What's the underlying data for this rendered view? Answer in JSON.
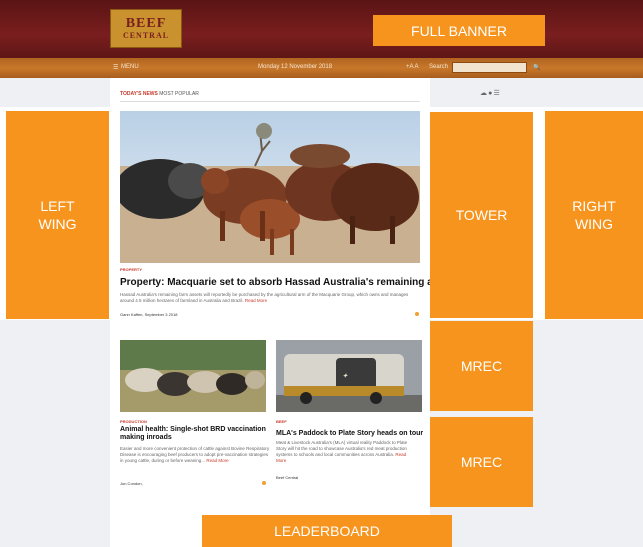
{
  "header": {
    "logo_line1": "BEEF",
    "logo_line2": "CENTRAL",
    "banner_label": "FULL BANNER"
  },
  "nav": {
    "menu_label": "MENU",
    "date": "Monday 12 November 2018",
    "text_size": "+A A",
    "search_label": "Search",
    "search_placeholder": ""
  },
  "tabs": {
    "todays_news": "TODAY'S NEWS",
    "most_popular": "MOST POPULAR"
  },
  "ads": {
    "left_wing": "LEFT\nWING",
    "right_wing": "RIGHT\nWING",
    "tower": "TOWER",
    "mrec1": "MREC",
    "mrec2": "MREC",
    "leaderboard": "LEADERBOARD"
  },
  "lead_story": {
    "category": "PROPERTY",
    "title": "Property: Macquarie set to absorb Hassad Australia's remaining assets",
    "summary": "Hassad Australia's remaining farm assets will reportedly be purchased by the agricultural arm of the Macquarie Group, which owns and manages around 4.5 million hectares of farmland in Australia and Brazil.",
    "read_more": "Read More",
    "byline": "Gann Kaffen, September 3 2018"
  },
  "story_left": {
    "category": "PRODUCTION",
    "title": "Animal health: Single-shot BRD vaccination making inroads",
    "summary": "Easier and more convenient protection of cattle against Bovine Respiratory Disease is encouraging beef producers to adopt pre-vaccination strategies in young cattle, during or before weaning...",
    "read_more": "Read More",
    "byline": "Jon Condon,"
  },
  "story_right": {
    "category": "BEEF",
    "title": "MLA's Paddock to Plate Story heads on tour",
    "summary": "Meat & Livestock Australia's (MLA) virtual reality Paddock to Plate Story will hit the road to showcase Australia's red meat production systems to schools and local communities across Australia.",
    "read_more": "Read More",
    "byline": "Beef Central"
  },
  "colors": {
    "ad_orange": "#f7941d",
    "header_red": "#6e1a1a",
    "nav_orange": "#c8782a",
    "accent_red": "#c8392b"
  }
}
